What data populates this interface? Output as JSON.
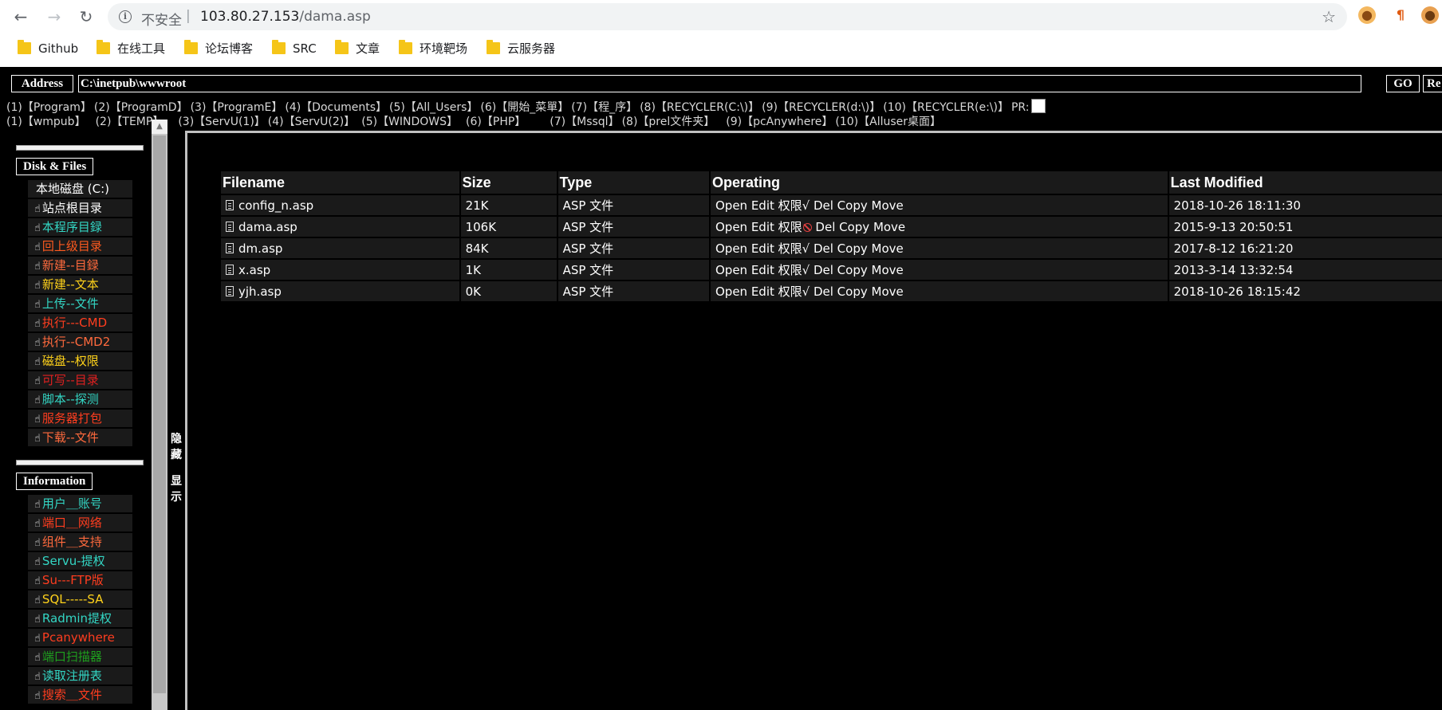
{
  "browser": {
    "insecure_label": "不安全",
    "separator": "|",
    "url_host": "103.80.27.153",
    "url_path": "/dama.asp",
    "bookmarks": [
      "Github",
      "在线工具",
      "论坛博客",
      "SRC",
      "文章",
      "环境靶场",
      "云服务器"
    ]
  },
  "address": {
    "label": "Address",
    "value": "C:\\inetpub\\wwwroot",
    "go_label": "GO",
    "re_label": "Re"
  },
  "quick_paths": {
    "row1": [
      "(1)【Program】",
      "(2)【ProgramD】",
      "(3)【ProgramE】",
      "(4)【Documents】",
      "(5)【All_Users】",
      "(6)【開始_菜單】",
      "(7)【程_序】",
      "(8)【RECYCLER(C:\\)】",
      "(9)【RECYCLER(d:\\)】",
      "(10)【RECYCLER(e:\\)】",
      "PR:"
    ],
    "row2": [
      "(1)【wmpub】",
      "(2)【TEMP】",
      "(3)【ServU(1)】",
      "(4)【ServU(2)】",
      "(5)【WINDOWS】",
      "(6)【PHP】",
      "(7)【Mssql】",
      "(8)【prel文件夹】",
      "(9)【pcAnywhere】",
      "(10)【Alluser桌面】"
    ]
  },
  "sidebar": {
    "disk_title": "Disk & Files",
    "drive": "本地磁盘 (C:)",
    "disk_items": [
      {
        "label": "站点根目录",
        "color": "#ffffff"
      },
      {
        "label": "本程序目録",
        "color": "#33d6c4"
      },
      {
        "label": "回上级目录",
        "color": "#ff5a1f"
      },
      {
        "label": "新建--目録",
        "color": "#ff6a3d"
      },
      {
        "label": "新建--文本",
        "color": "#ffd21a"
      },
      {
        "label": "上传--文件",
        "color": "#33d6c4"
      },
      {
        "label": "执行---CMD",
        "color": "#ff3d1f"
      },
      {
        "label": "执行--CMD2",
        "color": "#ff6a3d"
      },
      {
        "label": "磁盘--权限",
        "color": "#ffd21a"
      },
      {
        "label": "可写--目录",
        "color": "#e02020"
      },
      {
        "label": "脚本--探测",
        "color": "#33d6c4"
      },
      {
        "label": "服务器打包",
        "color": "#ff3d1f"
      },
      {
        "label": "下载--文件",
        "color": "#ff6a3d"
      }
    ],
    "info_title": "Information",
    "info_items": [
      {
        "label": "用户＿账号",
        "color": "#33d6c4"
      },
      {
        "label": "端口＿网络",
        "color": "#ff3d1f"
      },
      {
        "label": "组件＿支持",
        "color": "#ff6a3d"
      },
      {
        "label": "Servu-提权",
        "color": "#33d6c4"
      },
      {
        "label": "Su---FTP版",
        "color": "#ff3d1f"
      },
      {
        "label": "SQL-----SA",
        "color": "#ffd21a"
      },
      {
        "label": "Radmin提权",
        "color": "#33d6c4"
      },
      {
        "label": "Pcanywhere",
        "color": "#ff3d1f"
      },
      {
        "label": "端口扫描器",
        "color": "#1ea01e"
      },
      {
        "label": "读取注册表",
        "color": "#33d6c4"
      },
      {
        "label": "搜索＿文件",
        "color": "#ff3d1f"
      }
    ],
    "hide_label": "隐藏",
    "show_label": "显示"
  },
  "files": {
    "headers": [
      "Filename",
      "Size",
      "Type",
      "Operating",
      "Last Modified"
    ],
    "rows": [
      {
        "name": "config_n.asp",
        "size": "21K",
        "type": "ASP 文件",
        "ops_pre": "Open Edit 权限",
        "perm": "√",
        "ops_post": " Del Copy Move",
        "modified": "2018-10-26 18:11:30"
      },
      {
        "name": "dama.asp",
        "size": "106K",
        "type": "ASP 文件",
        "ops_pre": "Open Edit 权限",
        "perm": "",
        "ops_post": " Del Copy Move",
        "modified": "2015-9-13 20:50:51"
      },
      {
        "name": "dm.asp",
        "size": "84K",
        "type": "ASP 文件",
        "ops_pre": "Open Edit 权限",
        "perm": "√",
        "ops_post": " Del Copy Move",
        "modified": "2017-8-12 16:21:20"
      },
      {
        "name": "x.asp",
        "size": "1K",
        "type": "ASP 文件",
        "ops_pre": "Open Edit 权限",
        "perm": "√",
        "ops_post": " Del Copy Move",
        "modified": "2013-3-14 13:32:54"
      },
      {
        "name": "yjh.asp",
        "size": "0K",
        "type": "ASP 文件",
        "ops_pre": "Open Edit 权限",
        "perm": "√",
        "ops_post": " Del Copy Move",
        "modified": "2018-10-26 18:15:42"
      }
    ]
  }
}
